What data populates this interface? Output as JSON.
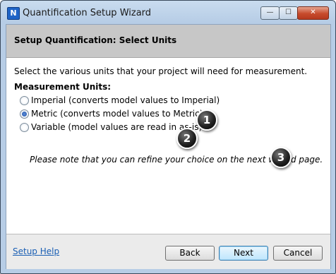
{
  "window": {
    "title": "Quantification Setup Wizard",
    "app_icon_letter": "N",
    "controls": {
      "minimize": "—",
      "maximize": "☐",
      "close": "✕"
    }
  },
  "header": {
    "title": "Setup Quantification: Select Units"
  },
  "main": {
    "description": "Select the various units that your project will need for measurement.",
    "units_label": "Measurement Units:",
    "options": [
      {
        "label": "Imperial (converts model values to Imperial)",
        "checked": false
      },
      {
        "label": "Metric (converts model values to Metric)",
        "checked": true
      },
      {
        "label": "Variable (model values are read in as-is)",
        "checked": false
      }
    ],
    "note": "Please note that you can refine your choice on the next wizard page.",
    "callouts": [
      "1",
      "2",
      "3"
    ]
  },
  "footer": {
    "help_link": "Setup Help",
    "back_label": "Back",
    "next_label": "Next",
    "cancel_label": "Cancel"
  }
}
